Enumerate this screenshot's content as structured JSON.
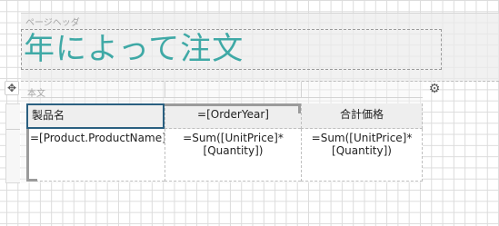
{
  "page_header": {
    "label": "ページヘッダ",
    "title": "年によって注文"
  },
  "body": {
    "label": "本文"
  },
  "table": {
    "headers": [
      "製品名",
      "=[OrderYear]",
      "合計価格"
    ],
    "details": [
      "=[Product.ProductName]",
      "=Sum([UnitPrice]*\n[Quantity])",
      "=Sum([UnitPrice]*\n[Quantity])"
    ]
  },
  "icons": {
    "move": "move-icon",
    "settings": "gear-icon"
  }
}
